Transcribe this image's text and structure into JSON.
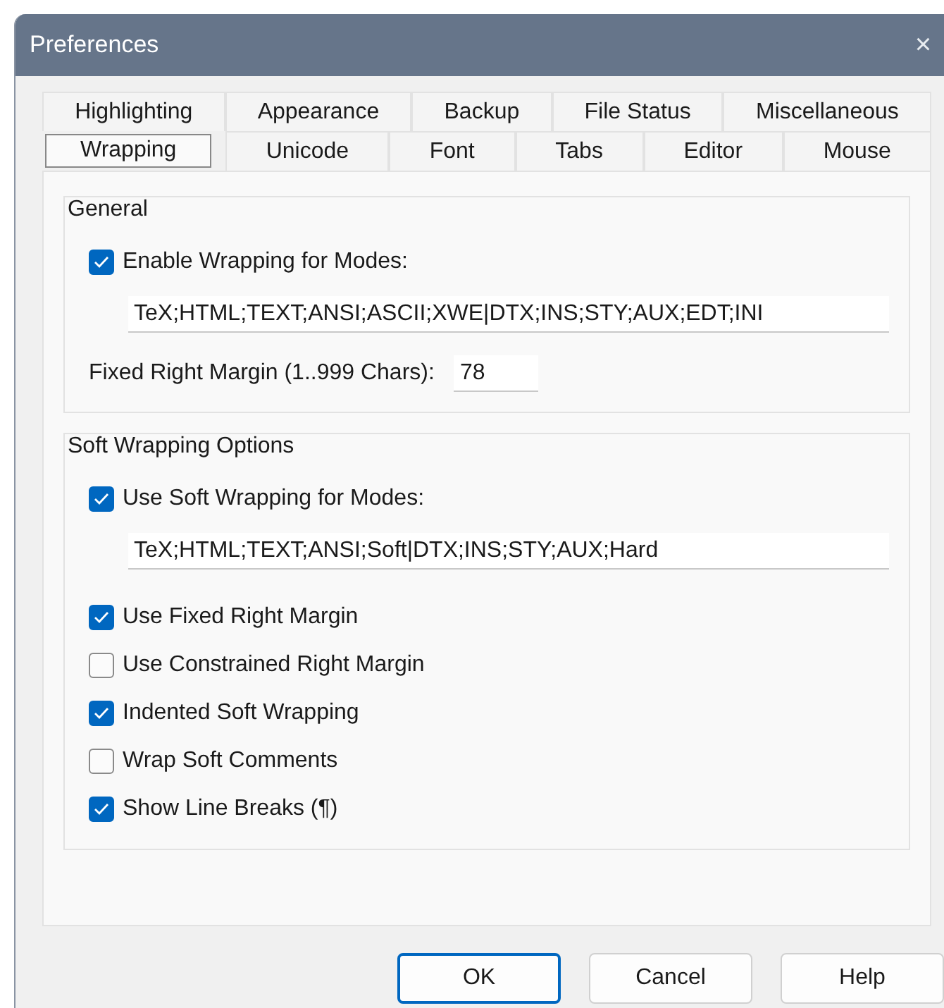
{
  "window": {
    "title": "Preferences",
    "close": "×"
  },
  "tab_rows": [
    {
      "tabs": [
        {
          "label": "Highlighting",
          "selected": false
        },
        {
          "label": "Appearance",
          "selected": false
        },
        {
          "label": "Backup",
          "selected": false
        },
        {
          "label": "File Status",
          "selected": false
        },
        {
          "label": "Miscellaneous",
          "selected": false
        }
      ]
    },
    {
      "tabs": [
        {
          "label": "Wrapping",
          "selected": true
        },
        {
          "label": "Unicode",
          "selected": false
        },
        {
          "label": "Font",
          "selected": false
        },
        {
          "label": "Tabs",
          "selected": false
        },
        {
          "label": "Editor",
          "selected": false
        },
        {
          "label": "Mouse",
          "selected": false
        }
      ]
    }
  ],
  "general": {
    "title": "General",
    "enable": {
      "label": "Enable Wrapping for Modes:",
      "checked": true
    },
    "modes": "TeX;HTML;TEXT;ANSI;ASCII;XWE|DTX;INS;STY;AUX;EDT;INI",
    "margin": {
      "label": "Fixed Right Margin (1..999 Chars):",
      "value": "78"
    }
  },
  "soft": {
    "title": "Soft Wrapping Options",
    "enable": {
      "label": "Use Soft Wrapping for Modes:",
      "checked": true
    },
    "modes": "TeX;HTML;TEXT;ANSI;Soft|DTX;INS;STY;AUX;Hard",
    "options": [
      {
        "label": "Use Fixed Right Margin",
        "checked": true
      },
      {
        "label": "Use Constrained Right Margin",
        "checked": false
      },
      {
        "label": "Indented Soft Wrapping",
        "checked": true
      },
      {
        "label": "Wrap Soft Comments",
        "checked": false
      },
      {
        "label": "Show Line Breaks (¶)",
        "checked": true
      }
    ]
  },
  "buttons": [
    {
      "label": "OK",
      "default": true
    },
    {
      "label": "Cancel",
      "default": false
    },
    {
      "label": "Help",
      "default": false
    }
  ]
}
